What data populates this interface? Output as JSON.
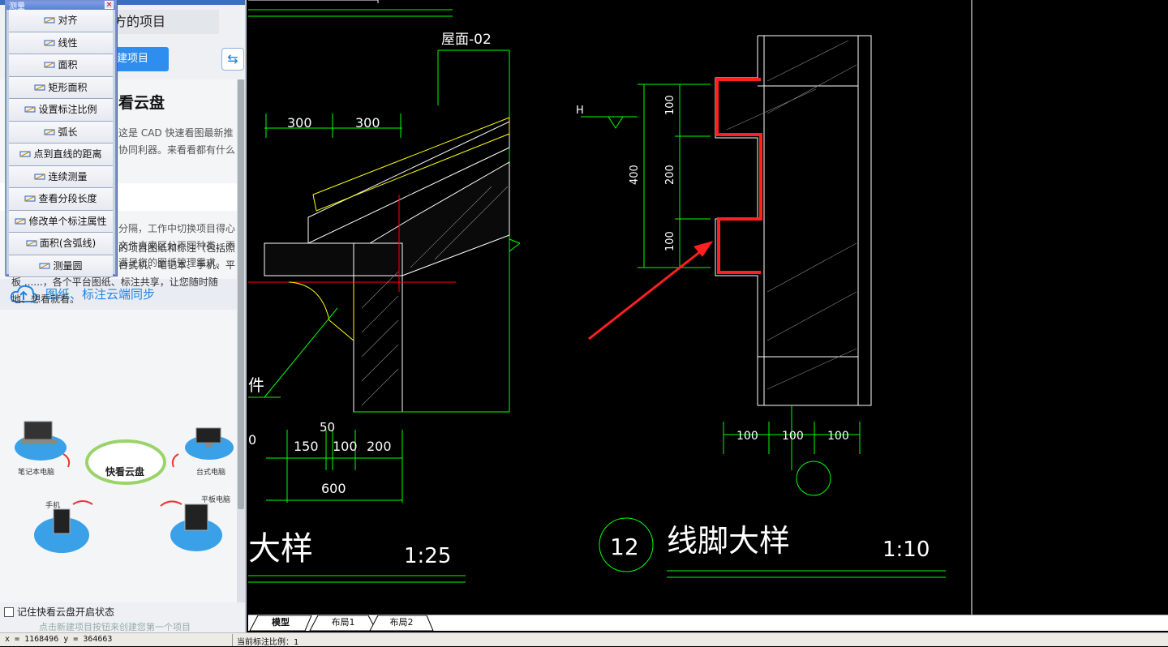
{
  "panel": {
    "recent_title": "方的项目",
    "new_project": "建项目",
    "sync_icon": "refresh-icon",
    "cloud_heading": "看云盘",
    "cloud_intro": "这是 CAD 快速看图最新推\n协同利器。来看看都有什么",
    "folders_text": "分隔，工作中切换项目得心\n文件夹来区分不同种类、不\n满足您的图纸管理需求。",
    "sync_heading": "图纸、标注云端同步",
    "sync_body": "一键同步快看云端内的项目图纸和标注（包括照片标注）到云端或本地。台式机、笔记本、手机、平板 ......，各个平台图纸、标注共享，让您随时随地、想看就看。",
    "devices": {
      "laptop": "笔记本电脑",
      "desktop": "台式电脑",
      "phone": "手机",
      "tablet": "平板电脑",
      "cloud": "快看云盘"
    },
    "remember": "记住快看云盘开启状态",
    "create_hint": "点击新建项目按钮来创建您第一个项目"
  },
  "measure": {
    "title": "测量",
    "items": [
      {
        "label": "对齐",
        "icon": "align-measure-icon"
      },
      {
        "label": "线性",
        "icon": "linear-measure-icon"
      },
      {
        "label": "面积",
        "icon": "area-icon"
      },
      {
        "label": "矩形面积",
        "icon": "rect-area-icon"
      },
      {
        "label": "设置标注比例",
        "icon": "scale-icon"
      },
      {
        "label": "弧长",
        "icon": "arc-length-icon"
      },
      {
        "label": "点到直线的距离",
        "icon": "point-line-icon"
      },
      {
        "label": "连续测量",
        "icon": "continuous-measure-icon"
      },
      {
        "label": "查看分段长度",
        "icon": "segment-length-icon"
      },
      {
        "label": "修改单个标注属性",
        "icon": "edit-annotation-icon"
      },
      {
        "label": "面积(含弧线)",
        "icon": "arc-area-icon"
      },
      {
        "label": "测量圆",
        "icon": "circle-measure-icon"
      }
    ]
  },
  "cad": {
    "left_detail": {
      "roof_label": "屋面-02",
      "dims_top": [
        "300",
        "300"
      ],
      "dims_bottom": [
        "150",
        "100",
        "200"
      ],
      "dim_50": "50",
      "dim_total": "600",
      "title_partial": "大样",
      "scale": "1:25",
      "left_char": "件",
      "left_zero": "0"
    },
    "right_detail": {
      "h_label": "H",
      "dims_vertical": [
        "100",
        "200",
        "100"
      ],
      "dim_total": "400",
      "dims_bottom": [
        "100",
        "100",
        "100"
      ],
      "detail_number": "12",
      "title": "线脚大样",
      "scale": "1:10"
    }
  },
  "tabs": [
    "模型",
    "布局1",
    "布局2"
  ],
  "status": {
    "coords": "x = 1168496 y = 364663",
    "scale": "当前标注比例：1"
  },
  "colors": {
    "cad_bg": "#000000",
    "green": "#00ff00",
    "white": "#ffffff",
    "red_highlight": "#ff2020",
    "accent_blue": "#2d8ef0"
  }
}
